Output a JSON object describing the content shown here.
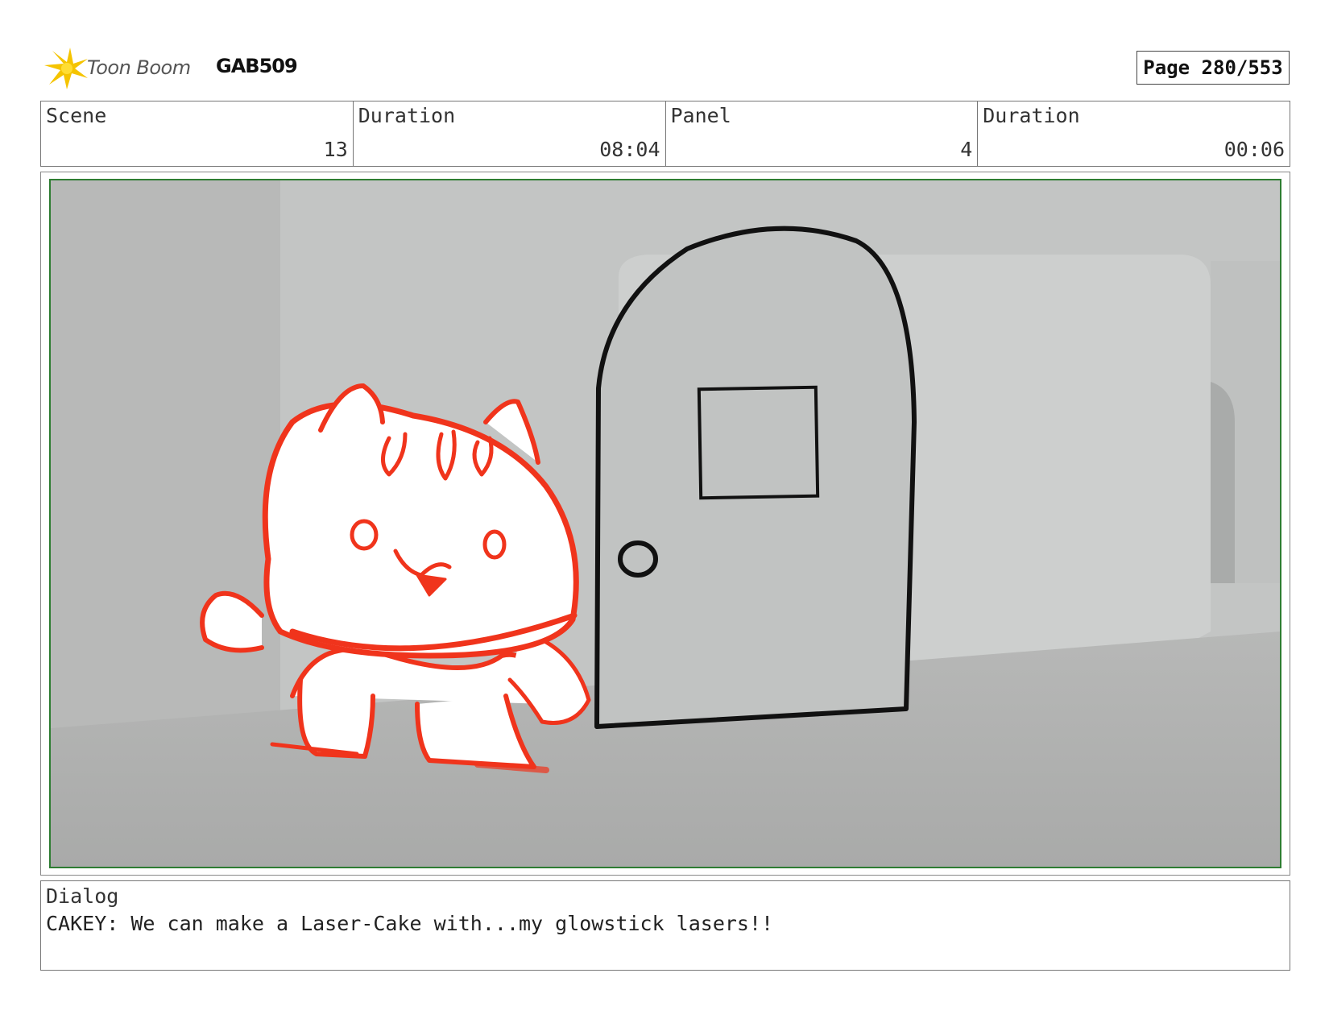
{
  "header": {
    "logo_text": "Toon Boom",
    "project_code": "GAB509",
    "page_label": "Page 280/553"
  },
  "info": {
    "scene_label": "Scene",
    "scene_value": "13",
    "scene_duration_label": "Duration",
    "scene_duration_value": "08:04",
    "panel_label": "Panel",
    "panel_value": "4",
    "panel_duration_label": "Duration",
    "panel_duration_value": "00:06"
  },
  "dialog": {
    "label": "Dialog",
    "text": "CAKEY: We can make a Laser-Cake with...my glowstick lasers!!"
  },
  "colors": {
    "panel_border": "#2e7d32",
    "sketch_red": "#f0341c",
    "door_line": "#111111",
    "background_grey": "#c4c6c5"
  }
}
